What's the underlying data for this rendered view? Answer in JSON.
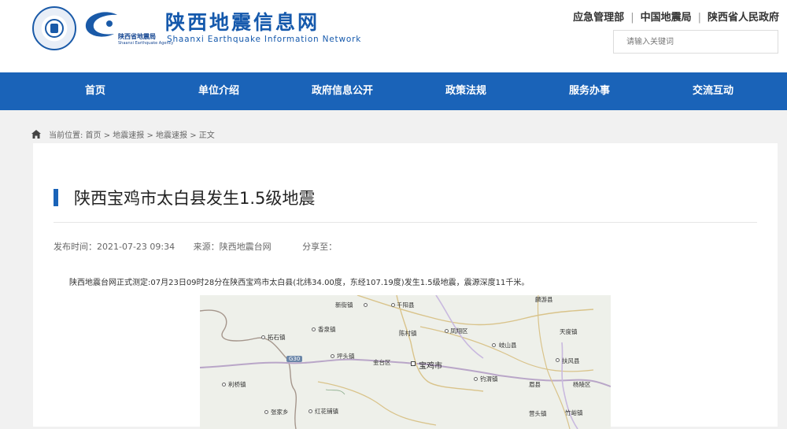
{
  "header": {
    "agency_cn": "陕西省地震局",
    "agency_en": "Shaanxi Earthquake Agency",
    "site_title": "陕西地震信息网",
    "site_subtitle": "Shaanxi Earthquake Information Network",
    "top_links": [
      "应急管理部",
      "中国地震局",
      "陕西省人民政府"
    ],
    "search_placeholder": "请输入关键词"
  },
  "nav": [
    "首页",
    "单位介绍",
    "政府信息公开",
    "政策法规",
    "服务办事",
    "交流互动"
  ],
  "breadcrumb": "当前位置: 首页 > 地震速报 > 地震速报 > 正文",
  "article": {
    "title": "陕西宝鸡市太白县发生1.5级地震",
    "publish_time": "发布时间：2021-07-23 09:34",
    "source": "来源：陕西地震台网",
    "share": "分享至：",
    "body": "陕西地震台网正式测定:07月23日09时28分在陕西宝鸡市太白县(北纬34.00度，东经107.19度)发生1.5级地震，震源深度11千米。"
  },
  "map": {
    "highway": "G30",
    "labels": [
      "新街镇",
      "千阳县",
      "麟游县",
      "香泉镇",
      "拓石镇",
      "凤翔区",
      "陈村镇",
      "天度镇",
      "岐山县",
      "坪头镇",
      "金台区",
      "宝鸡市",
      "扶风县",
      "利桥镇",
      "钓渭镇",
      "眉县",
      "杨陵区",
      "张家乡",
      "红花铺镇",
      "营头镇",
      "竹峪镇"
    ]
  },
  "colors": {
    "brand_blue": "#1a63b8",
    "title_blue": "#1559ac"
  }
}
